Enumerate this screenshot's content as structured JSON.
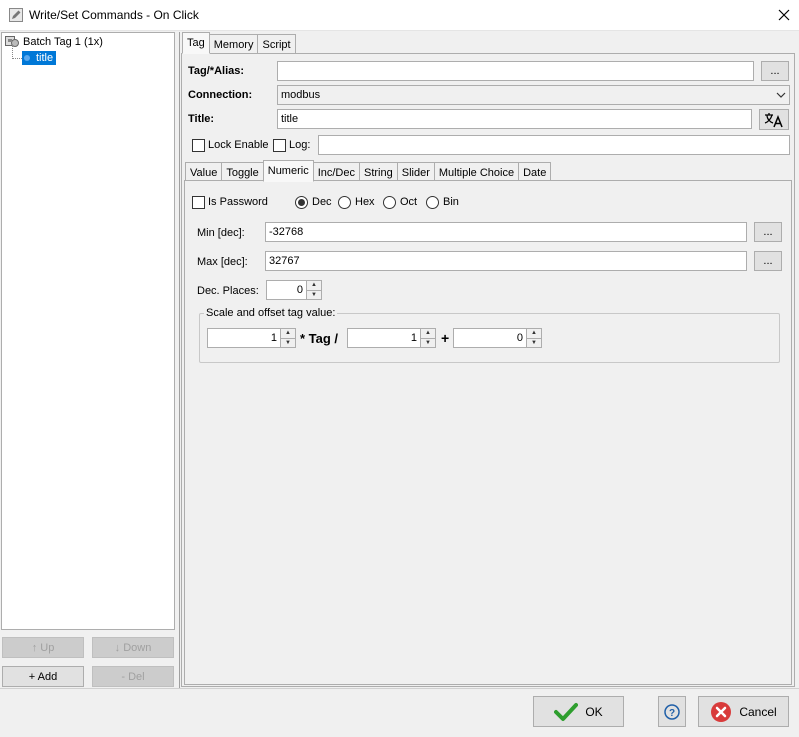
{
  "window": {
    "title": "Write/Set Commands - On Click"
  },
  "tree": {
    "root_label": "Batch Tag 1 (1x)",
    "child_label": "title"
  },
  "left_buttons": {
    "up": "↑ Up",
    "down": "↓ Down",
    "add": "+ Add",
    "del": "- Del"
  },
  "top_tabs": [
    "Tag",
    "Memory",
    "Script"
  ],
  "form": {
    "tag_alias_label": "Tag/*Alias:",
    "tag_alias_value": "",
    "connection_label": "Connection:",
    "connection_value": "modbus",
    "title_label": "Title:",
    "title_value": "title",
    "lock_enable_label": "Lock Enable",
    "log_label": "Log:",
    "log_value": "",
    "browse_label": "..."
  },
  "sub_tabs": [
    "Value",
    "Toggle",
    "Numeric",
    "Inc/Dec",
    "String",
    "Slider",
    "Multiple Choice",
    "Date"
  ],
  "numeric": {
    "is_password_label": "Is Password",
    "radix_options": [
      "Dec",
      "Hex",
      "Oct",
      "Bin"
    ],
    "radix_selected": "Dec",
    "min_label": "Min [dec]:",
    "min_value": "-32768",
    "max_label": "Max [dec]:",
    "max_value": "32767",
    "dec_places_label": "Dec. Places:",
    "dec_places_value": "0",
    "scale_group_label": "Scale and offset tag value:",
    "scale_value": "1",
    "times_tag_label": "* Tag /",
    "divisor_value": "1",
    "plus_label": "+",
    "offset_value": "0"
  },
  "dialog_buttons": {
    "ok": "OK",
    "help": "?",
    "cancel": "Cancel"
  },
  "colors": {
    "selection": "#0078d7",
    "ok_check": "#2e9e2e",
    "cancel_icon": "#d83b3b",
    "help_icon": "#1f5fa8"
  }
}
